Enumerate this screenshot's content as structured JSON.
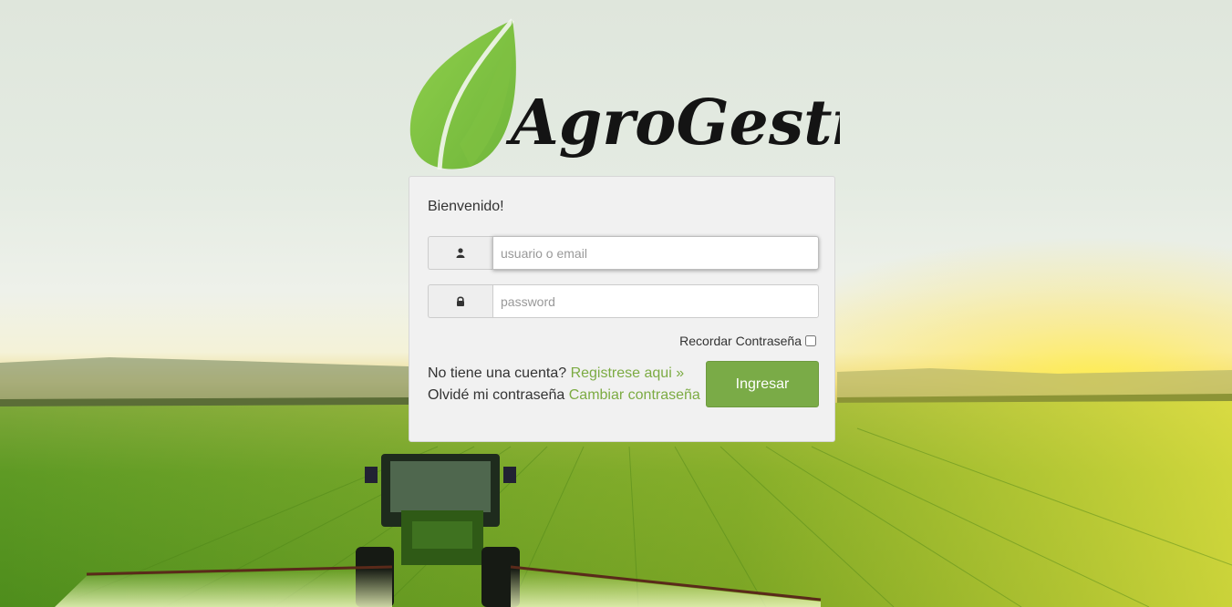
{
  "brand": {
    "name": "AgroGestión"
  },
  "login": {
    "welcome": "Bienvenido!",
    "username_placeholder": "usuario o email",
    "password_placeholder": "password",
    "remember_label": "Recordar Contraseña",
    "no_account_text": "No tiene una cuenta?",
    "register_link": "Registrese aqui »",
    "forgot_text": "Olvidé mi contraseña",
    "change_password_link": "Cambiar contraseña",
    "submit_label": "Ingresar"
  },
  "icons": {
    "username_icon": "user-icon",
    "password_icon": "lock-icon"
  },
  "colors": {
    "accent": "#7aab47",
    "link": "#7cab43",
    "card_bg": "#f1f1f1"
  }
}
